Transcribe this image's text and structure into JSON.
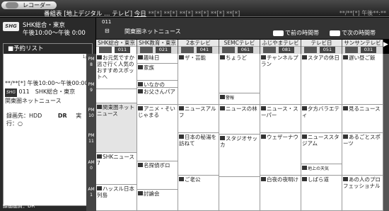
{
  "header": {
    "app": "レコーダー",
    "title": "番組表 [地上デジタル … テレビ]",
    "today": "今日",
    "days": [
      "**[*]",
      "**[*]",
      "**[*]",
      "**[*]",
      "**[*]",
      "**[*]",
      "**[*]"
    ],
    "date_right": "**/**[*] 午後**:**"
  },
  "current": {
    "logo": "SHG",
    "channel": "SHK総合・東京",
    "time": "午後10:00〜午後 0:00"
  },
  "left_panel": {
    "list_title": "■予約リスト",
    "count": "1/1",
    "item_line1": "**/**[*] 午後10:00〜午後00:00",
    "item_line2_logo": "SHG",
    "item_line2": "011　SHK総合・東京",
    "item_line3": "関東圏ネットニュース",
    "rec_label": "録画先：HDD",
    "rec_mode": "DR",
    "exec": "実行：○",
    "footer": "録画画質：DR"
  },
  "grid_top": {
    "ch_code": "011",
    "now_program": "関東圏ネットニュース",
    "prev_label": "で前の時間帯",
    "next_label": "で次の時間帯"
  },
  "channels": [
    {
      "name": "SHK総合・東京",
      "num": "011"
    },
    {
      "name": "SHK教育・東京",
      "num": "021"
    },
    {
      "name": "2本テレビ",
      "num": "041"
    },
    {
      "name": "SEMCテレビ",
      "num": "061"
    },
    {
      "name": "ふじやまテレビ",
      "num": "081"
    },
    {
      "name": "テレビ日",
      "num": "051"
    },
    {
      "name": "サンサンテレビ",
      "num": "031"
    }
  ],
  "times": [
    "PM 8",
    "PM 9",
    "PM 10",
    "PM 11",
    "AM 0",
    "AM 1"
  ],
  "programs": {
    "c1": [
      "お元気ですか 逃さ行く人気のおすすめスポットへ",
      "関東圏ネットニュース",
      "SHKニュース7",
      "ハッスル日本列島"
    ],
    "c2": [
      "趣味日",
      "家族",
      "いなかの",
      "お父さんパア",
      "アニメ・そいじゃまる",
      "名探偵ボロ",
      "討論会"
    ],
    "c3": [
      "ザ・芸能",
      "ニュースアルフ",
      "日本の秘湯を訪ねて",
      "ご老公"
    ],
    "c4": [
      "ちょうど",
      "警報",
      "ニュースの林",
      "スタジオサッカ"
    ],
    "c5": [
      "チャンネルプラン",
      "ニュース・スーパー",
      "ウェザーナウ",
      "白夜の夜明け"
    ],
    "c6": [
      "スタアの休日",
      "夕方バラエティ",
      "ニューススタジアム",
      "地上の天気",
      "しばら道"
    ],
    "c7": [
      "遅い昼ご飯",
      "見るニュース",
      "あるごとスポーツ",
      "あの人のプロフェッショナル"
    ]
  }
}
